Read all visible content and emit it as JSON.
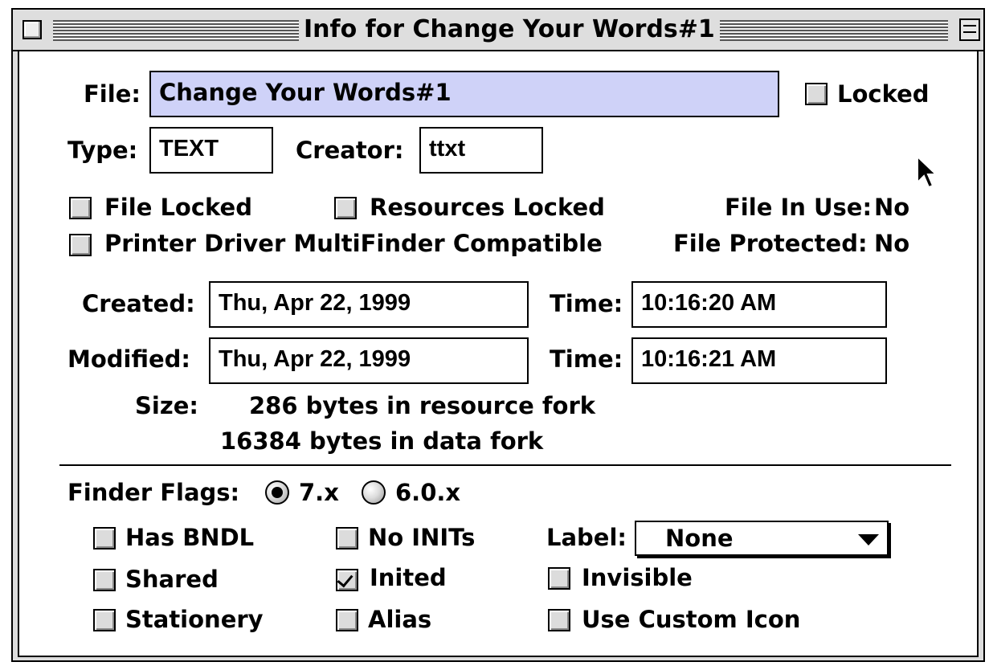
{
  "window": {
    "title": "Info for Change Your Words#1"
  },
  "file": {
    "label": "File:",
    "value": "Change Your Words#1",
    "locked_label": "Locked",
    "locked": false
  },
  "type": {
    "label": "Type:",
    "value": "TEXT"
  },
  "creator": {
    "label": "Creator:",
    "value": "ttxt"
  },
  "flags_top": {
    "file_locked": "File Locked",
    "resources_locked": "Resources Locked",
    "printer_driver": "Printer Driver MultiFinder Compatible",
    "file_in_use_label": "File In Use:",
    "file_in_use_value": "No",
    "file_protected_label": "File Protected:",
    "file_protected_value": "No"
  },
  "created": {
    "label": "Created:",
    "date": "Thu, Apr 22, 1999",
    "time_label": "Time:",
    "time": "10:16:20 AM"
  },
  "modified": {
    "label": "Modified:",
    "date": "Thu, Apr 22, 1999",
    "time_label": "Time:",
    "time": "10:16:21 AM"
  },
  "size": {
    "label": "Size:",
    "resource": "286 bytes in resource fork",
    "data": "16384 bytes in data fork"
  },
  "finder_flags": {
    "label": "Finder Flags:",
    "option_7x": "7.x",
    "option_60x": "6.0.x",
    "selected": "7.x"
  },
  "checkboxes": {
    "has_bndl": "Has BNDL",
    "no_inits": "No INITs",
    "shared": "Shared",
    "inited": "Inited",
    "invisible": "Invisible",
    "stationery": "Stationery",
    "alias": "Alias",
    "use_custom_icon": "Use Custom Icon"
  },
  "label_popup": {
    "label": "Label:",
    "value": "None"
  }
}
